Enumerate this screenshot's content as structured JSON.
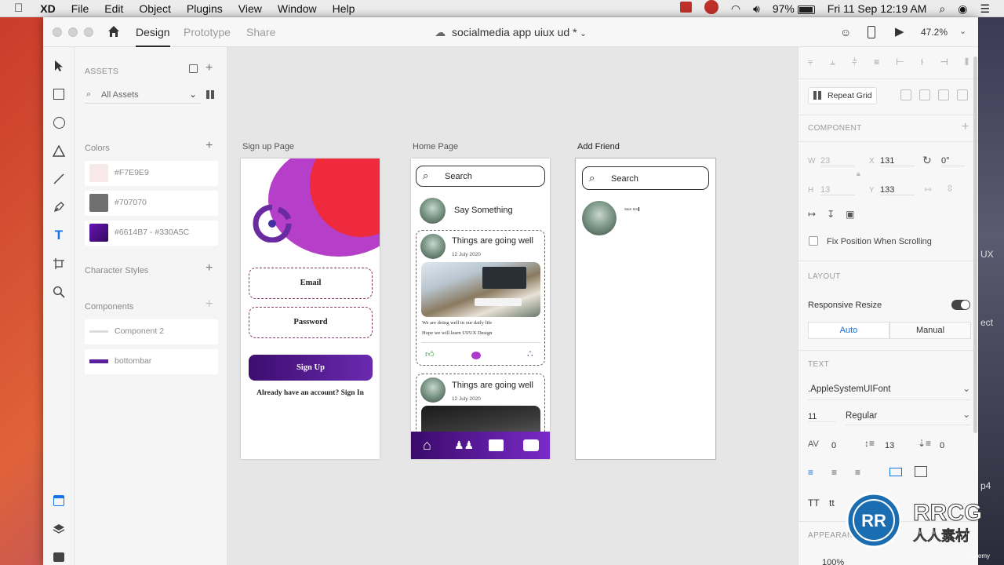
{
  "menubar": {
    "apple": "",
    "items": [
      "XD",
      "File",
      "Edit",
      "Object",
      "Plugins",
      "View",
      "Window",
      "Help"
    ],
    "battery": "97%",
    "datetime": "Fri 11 Sep  12:19 AM"
  },
  "titlebar": {
    "tabs": [
      "Design",
      "Prototype",
      "Share"
    ],
    "active_tab": "Design",
    "document": "socialmedia app uiux ud *",
    "zoom": "47.2%"
  },
  "assets": {
    "heading": "ASSETS",
    "filter": "All Assets",
    "colors_heading": "Colors",
    "colors": [
      {
        "label": "#F7E9E9",
        "color": "#F7E9E9"
      },
      {
        "label": "#707070",
        "color": "#707070"
      },
      {
        "label": "#6614B7 - #330A5C",
        "color": "#6614B7"
      }
    ],
    "char_styles_heading": "Character Styles",
    "components_heading": "Components",
    "components": [
      "Component 2",
      "bottombar"
    ]
  },
  "canvas": {
    "signup": {
      "label": "Sign up Page",
      "email": "Email",
      "password": "Password",
      "signup_button": "Sign Up",
      "signin_text": "Already have an account? Sign In"
    },
    "home": {
      "label": "Home Page",
      "search": "Search",
      "say_something": "Say Something",
      "post_title": "Things are going well",
      "post_date": "12 July 2020",
      "post_text_1": "We are doing well in our daily life",
      "post_text_2": "Hope we will learn UI/UX Design",
      "post2_title": "Things are going well",
      "post2_date": "12 July 2020"
    },
    "addfriend": {
      "label": "Add Friend",
      "search": "Search",
      "name": "Sam Sm"
    }
  },
  "props": {
    "repeat_grid": "Repeat Grid",
    "component_heading": "COMPONENT",
    "w_label": "W",
    "w_value": "23",
    "x_label": "X",
    "x_value": "131",
    "rotation": "0°",
    "h_label": "H",
    "h_value": "13",
    "y_label": "Y",
    "y_value": "133",
    "fix_position": "Fix Position When Scrolling",
    "layout_heading": "LAYOUT",
    "responsive_resize": "Responsive Resize",
    "auto": "Auto",
    "manual": "Manual",
    "text_heading": "TEXT",
    "font": ".AppleSystemUIFont",
    "font_size": "11",
    "font_weight": "Regular",
    "char_spacing": "0",
    "line_spacing": "13",
    "para_spacing": "0",
    "tt_upper": "TT",
    "tt_lower": "tt",
    "appearance_heading": "APPEARANCE",
    "opacity": "100%"
  },
  "side_text": {
    "uix": "UX",
    "ect": "ect",
    "p4": "p4",
    "udemy": "udemy"
  }
}
